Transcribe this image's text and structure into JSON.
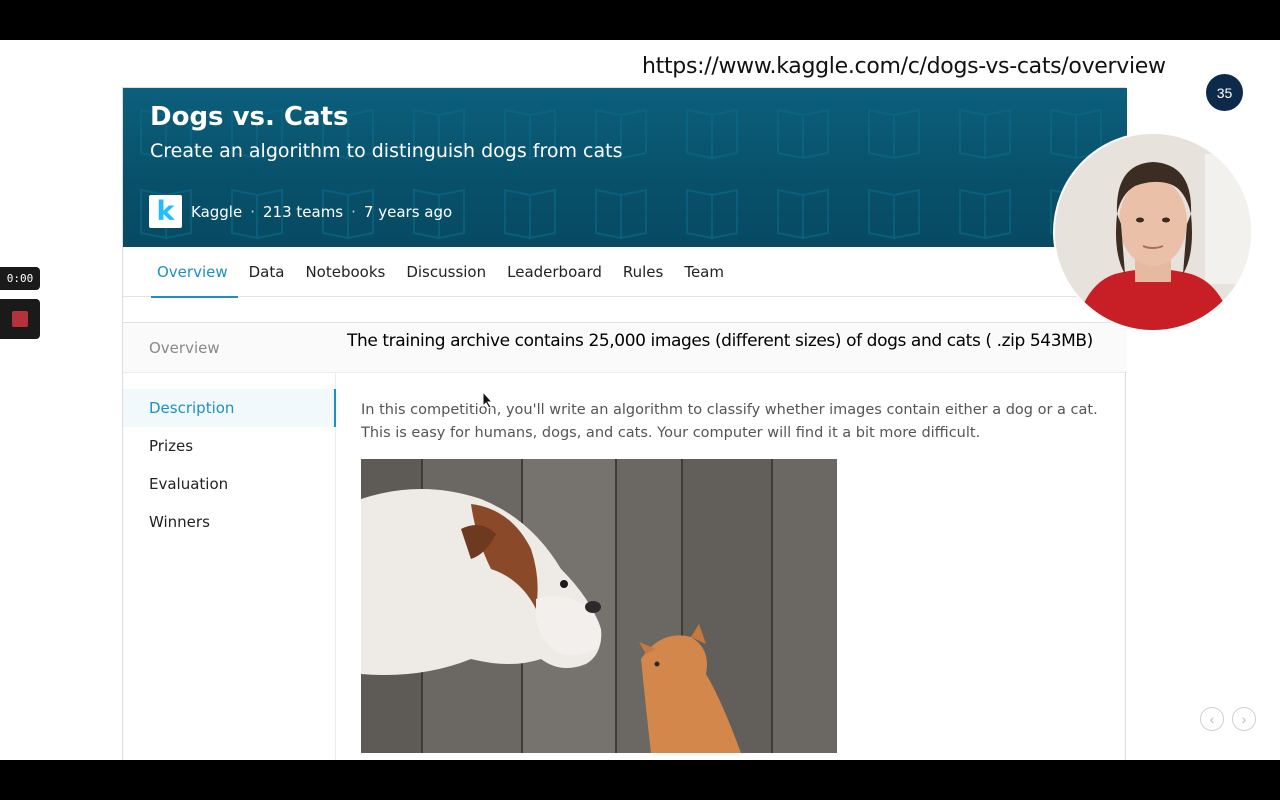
{
  "slide": {
    "url_caption": "https://www.kaggle.com/c/dogs-vs-cats/overview",
    "page_number": "35"
  },
  "competition": {
    "title": "Dogs vs. Cats",
    "subtitle": "Create an algorithm to distinguish dogs from cats",
    "logo_letter": "k",
    "host": "Kaggle",
    "teams": "213 teams",
    "age": "7 years ago",
    "separator": "·"
  },
  "tabs": [
    {
      "label": "Overview",
      "active": true
    },
    {
      "label": "Data",
      "active": false
    },
    {
      "label": "Notebooks",
      "active": false
    },
    {
      "label": "Discussion",
      "active": false
    },
    {
      "label": "Leaderboard",
      "active": false
    },
    {
      "label": "Rules",
      "active": false
    },
    {
      "label": "Team",
      "active": false
    }
  ],
  "overview": {
    "section_label": "Overview",
    "annotation": "The training archive contains 25,000 images (different sizes) of dogs and cats ( .zip 543MB)",
    "side_nav": [
      {
        "label": "Description",
        "active": true
      },
      {
        "label": "Prizes",
        "active": false
      },
      {
        "label": "Evaluation",
        "active": false
      },
      {
        "label": "Winners",
        "active": false
      }
    ],
    "description": "In this competition, you'll write an algorithm to classify whether images contain either a dog or a cat.  This is easy for humans, dogs, and cats. Your computer will find it a bit more difficult."
  },
  "recorder": {
    "timer": "0:00"
  },
  "icons": {
    "prev": "chevron-left-icon",
    "next": "chevron-right-icon",
    "record": "stop-icon"
  },
  "colors": {
    "banner": "#0c5f7c",
    "accent": "#1f8fc0",
    "slide_badge": "#0e2a4a"
  }
}
